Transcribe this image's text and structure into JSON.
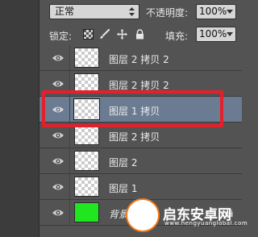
{
  "toolbar": {
    "blend_mode": "正常",
    "opacity_label": "不透明度:",
    "opacity_value": "100%",
    "lock_label": "锁定:",
    "fill_label": "填充:",
    "fill_value": "100%"
  },
  "layers": [
    {
      "name": "图层 2 拷贝 2",
      "thumb": "transparent",
      "visible": true,
      "selected": false
    },
    {
      "name": "图层 2 拷贝 2",
      "thumb": "transparent",
      "visible": true,
      "selected": false
    },
    {
      "name": "图层 1 拷贝",
      "thumb": "transparent",
      "visible": true,
      "selected": true
    },
    {
      "name": "图层 2 拷贝",
      "thumb": "transparent",
      "visible": true,
      "selected": false
    },
    {
      "name": "图层 2",
      "thumb": "transparent",
      "visible": true,
      "selected": false
    },
    {
      "name": "图层 1",
      "thumb": "transparent",
      "visible": true,
      "selected": false
    },
    {
      "name": "背景",
      "thumb": "green",
      "visible": true,
      "selected": false,
      "locked": true
    }
  ],
  "colors": {
    "panel_bg": "#535353",
    "selected_row": "#6b7b91",
    "highlight": "#e3202b",
    "background_layer_fill": "#1fe61f"
  },
  "watermark": {
    "logo_text": "启东安卓网",
    "logo_url_text": "www.hengyuanglobal.com"
  }
}
